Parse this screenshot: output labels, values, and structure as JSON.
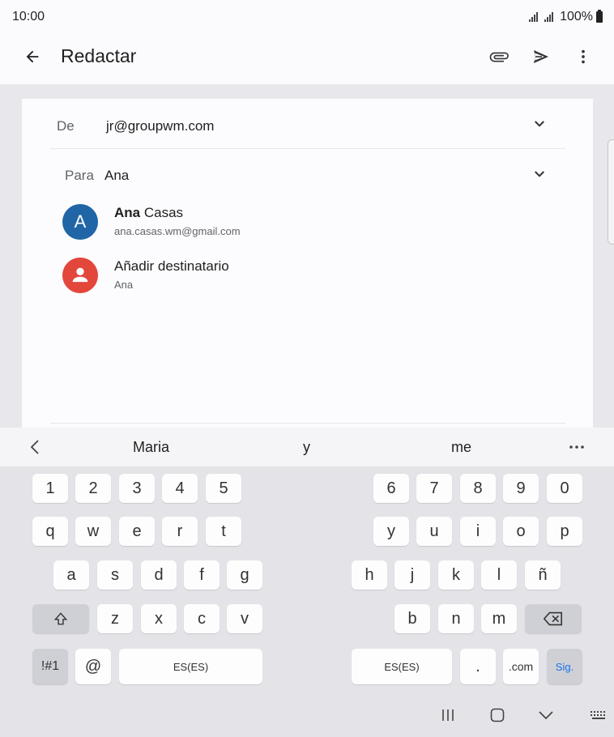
{
  "status": {
    "time": "10:00",
    "battery": "100%"
  },
  "app_bar": {
    "title": "Redactar"
  },
  "compose": {
    "from_label": "De",
    "from_value": "jr@groupwm.com",
    "to_label": "Para",
    "to_value": "Ana",
    "suggestions": [
      {
        "avatar": "A",
        "name_bold": "Ana",
        "name_rest": " Casas",
        "sub": "ana.casas.wm@gmail.com",
        "color": "#2065a5"
      },
      {
        "avatar": "person-icon",
        "name_bold": "",
        "name_rest": "Añadir destinatario",
        "sub": "Ana",
        "color": "#e3463b"
      }
    ]
  },
  "keyboard": {
    "suggestions": [
      "Maria",
      "y",
      "me"
    ],
    "row_numbers": [
      "1",
      "2",
      "3",
      "4",
      "5",
      "6",
      "7",
      "8",
      "9",
      "0"
    ],
    "row_q": [
      "q",
      "w",
      "e",
      "r",
      "t",
      "y",
      "u",
      "i",
      "o",
      "p"
    ],
    "row_a": [
      "a",
      "s",
      "d",
      "f",
      "g",
      "h",
      "j",
      "k",
      "l",
      "ñ"
    ],
    "row_z": [
      "z",
      "x",
      "c",
      "v",
      "b",
      "n",
      "m"
    ],
    "symbols": "!#1",
    "at": "@",
    "space_left": "ES(ES)",
    "space_right": "ES(ES)",
    "period": ".",
    "dotcom": ".com",
    "next": "Sig."
  },
  "colors": {
    "accent": "#1a73e8"
  }
}
